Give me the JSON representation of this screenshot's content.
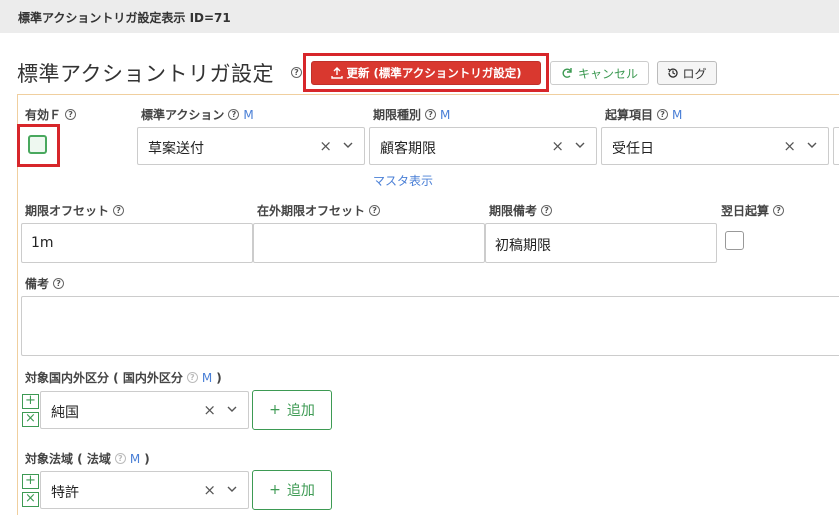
{
  "window": {
    "title": "標準アクショントリガ設定表示 ID=71"
  },
  "header": {
    "title": "標準アクショントリガ設定",
    "update_button": "更新 (標準アクショントリガ設定)",
    "cancel_button": "キャンセル",
    "log_button": "ログ"
  },
  "form": {
    "help_glyph": "?",
    "master_marker": "M",
    "clear_glyph": "×",
    "enabled": {
      "label": "有効Ｆ",
      "checked": false
    },
    "standard_action": {
      "label": "標準アクション",
      "value": "草案送付"
    },
    "deadline_type": {
      "label": "期限種別",
      "value": "顧客期限",
      "master_link": "マスタ表示"
    },
    "start_item": {
      "label": "起算項目",
      "value": "受任日"
    },
    "deadline_offset": {
      "label": "期限オフセット",
      "value": "1m"
    },
    "foreign_offset": {
      "label": "在外期限オフセット",
      "value": ""
    },
    "deadline_note": {
      "label": "期限備考",
      "value": "初稿期限"
    },
    "next_day": {
      "label": "翌日起算",
      "checked": false
    },
    "remarks": {
      "label": "備考",
      "value": ""
    },
    "target_domestic": {
      "label": "対象国内外区分 ( 国内外区分",
      "label_close": ")",
      "value": "純国",
      "add_button": "追加"
    },
    "target_jurisdiction": {
      "label": "対象法域 ( 法域",
      "label_close": ")",
      "value": "特許",
      "add_button": "追加"
    },
    "row_add_glyph": "+",
    "row_remove_glyph": "×"
  },
  "colors": {
    "accent_red": "#d9382f",
    "accent_green": "#3d9a53",
    "link_blue": "#4a7fd6",
    "panel_border": "#f0cf9f"
  }
}
